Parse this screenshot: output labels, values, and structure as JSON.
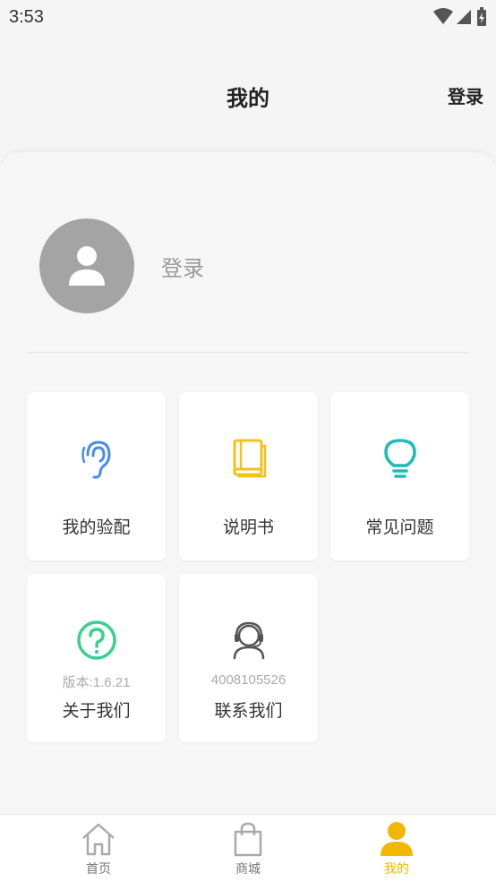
{
  "status_bar": {
    "time": "3:53"
  },
  "header": {
    "title": "我的",
    "login": "登录"
  },
  "profile": {
    "login_label": "登录"
  },
  "tiles": [
    {
      "label": "我的验配",
      "icon": "ear-icon",
      "color": "#4a8be8"
    },
    {
      "label": "说明书",
      "icon": "book-icon",
      "color": "#f2c21b"
    },
    {
      "label": "常见问题",
      "icon": "lightbulb-icon",
      "color": "#1dbcb8"
    },
    {
      "label": "关于我们",
      "sub": "版本:1.6.21",
      "icon": "question-icon",
      "color": "#3ccf8e"
    },
    {
      "label": "联系我们",
      "sub": "4008105526",
      "icon": "headset-icon",
      "color": "#555555"
    }
  ],
  "bottom_nav": [
    {
      "label": "首页",
      "icon": "home-icon"
    },
    {
      "label": "商城",
      "icon": "shopping-bag-icon"
    },
    {
      "label": "我的",
      "icon": "user-icon",
      "active": true
    }
  ],
  "colors": {
    "accent": "#f2b705",
    "background": "#f5f5f5"
  }
}
